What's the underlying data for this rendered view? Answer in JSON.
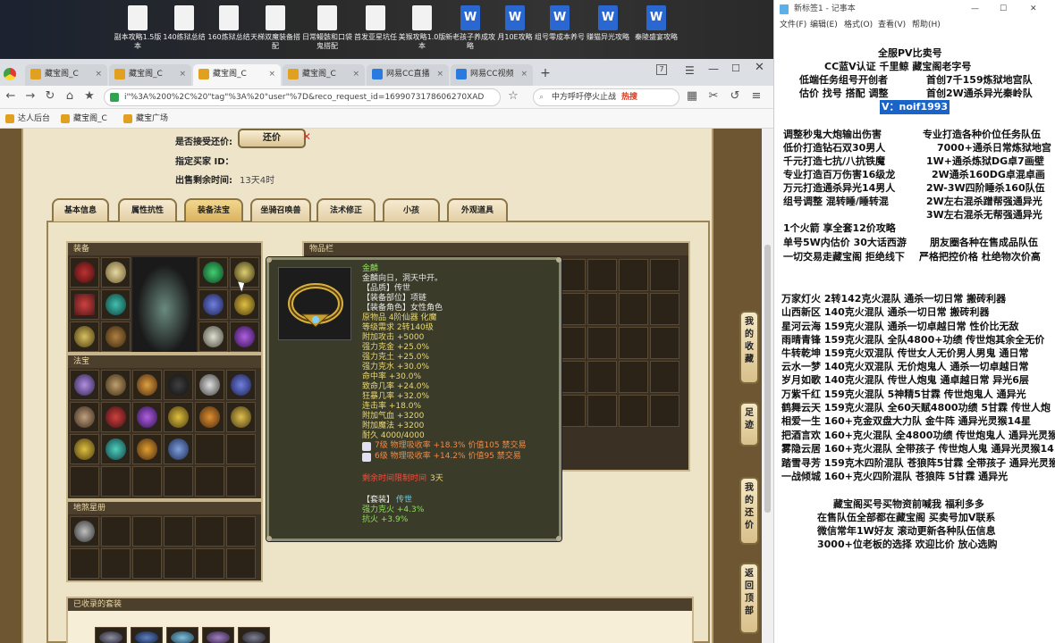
{
  "desktop": {
    "icons": [
      {
        "label": "副本攻略1.5版本",
        "type": "doc"
      },
      {
        "label": "140练狱总结",
        "type": "doc"
      },
      {
        "label": "160炼狱总结",
        "type": "doc"
      },
      {
        "label": "天梯双魔装备搭配",
        "type": "doc"
      },
      {
        "label": "日常鳗骸和口袋鬼搭配",
        "type": "doc"
      },
      {
        "label": "首发亚星坑任",
        "type": "doc"
      },
      {
        "label": "美猴攻略1.0版本",
        "type": "doc"
      },
      {
        "label": "新老孩子养成攻略",
        "type": "word"
      },
      {
        "label": "月10E攻略",
        "type": "word"
      },
      {
        "label": "组号零成本养号",
        "type": "word"
      },
      {
        "label": "赚猫异光攻略",
        "type": "word"
      },
      {
        "label": "秦陵盛宴攻略",
        "type": "word"
      }
    ]
  },
  "browser": {
    "tabs": [
      {
        "label": "藏宝阁_C"
      },
      {
        "label": "藏宝阁_C"
      },
      {
        "label": "藏宝阁_C"
      },
      {
        "label": "藏宝阁_C"
      },
      {
        "label": "网易CC直播"
      },
      {
        "label": "网易CC视频"
      }
    ],
    "new_tab": "+",
    "url": "i\"%3A%200%2C%20\"tag\"%3A%20\"user\"%7D&reco_request_id=1699073178606270XAD",
    "search": "中方呼吁停火止战",
    "hot_label": "热搜",
    "bookmarks": [
      {
        "label": "达人后台"
      },
      {
        "label": "藏宝阁_C"
      },
      {
        "label": "藏宝广场"
      }
    ]
  },
  "page": {
    "accept_offer_label": "是否接受还价:",
    "offer_button": "还价",
    "buyer_id_label": "指定买家 ID：",
    "time_left_label": "出售剩余时间:",
    "time_left_value": "13天4时",
    "tabs": [
      "基本信息",
      "属性抗性",
      "装备法宝",
      "坐骑召唤兽",
      "法术修正",
      "小孩",
      "外观道具"
    ],
    "active_tab": 2,
    "equip_title": "装备",
    "fabao_title": "法宝",
    "soul_title": "地煞星册",
    "inventory_title": "物品栏",
    "collected_title": "已收录的套装",
    "side_buttons": [
      "我的收藏",
      "足迹",
      "我的还价",
      "返回顶部"
    ]
  },
  "tooltip": {
    "name": "金麟",
    "desc": "金麟向日，洞天中开。",
    "quality": "【品质】传世",
    "slot": "【装备部位】项链",
    "role": "【装备角色】女性角色",
    "material": "原物品 4阶仙器 化魔",
    "level": "等级需求 2转140级",
    "stats": [
      "附加攻击 +5000",
      "强力克金 +25.0%",
      "强力克土 +25.0%",
      "强力克水 +30.0%",
      "命中率 +30.0%",
      "致命几率 +24.0%",
      "狂暴几率 +32.0%",
      "连击率 +18.0%",
      "附加气血 +3200",
      "附加魔法 +3200",
      "耐久 4000/4000"
    ],
    "gems": [
      "7级 物理吸收率 +18.3% 价值105 禁交易",
      "6级 物理吸收率 +14.2% 价值95 禁交易"
    ],
    "trade_limit": "剩余时间限制时间",
    "trade_limit_value": "3天",
    "set_label": "【套装】",
    "set_name": "传世",
    "set_stats": [
      "强力克火 +4.3%",
      "抗火 +3.9%"
    ]
  },
  "notepad": {
    "title": "新标签1 - 记事本",
    "menu": [
      "文件(F)",
      "编辑(E)",
      "格式(O)",
      "查看(V)",
      "帮助(H)"
    ],
    "lines": [
      "全服PV比卖号",
      "CC蓝V认证 千里鲸 藏宝阁老字号",
      "低端任务组号开创者",
      "首创7千159炼狱地宫队",
      "估价 找号 搭配 调整",
      "首创2W通杀异光秦岭队",
      "V：noif1993",
      "调整秒鬼大炮输出伤害",
      "专业打造各种价位任务队伍",
      "低价打造钻石双30男人",
      "7000+通杀日常炼狱地宫",
      "千元打造七抗/八抗铁魔",
      "1W+通杀炼狱DG卓7画壁",
      "专业打造百万伤害16级龙",
      "2W通杀160DG卓混卓画",
      "万元打造通杀异光14男人",
      "2W-3W四阶睡杀160队伍",
      "组号调整 混转睡/睡转混",
      "2W左右混杀蹭帮强通异光",
      "3W左右混杀无帮强通异光",
      "1个火箭 享全套12价攻略",
      "单号5W内估价 30大话西游",
      "朋友圈各种在售成品队伍",
      "一切交易走藏宝阁 拒绝线下",
      "严格把控价格 杜绝物次价高",
      "万家灯火 2转142克火混队 通杀一切日常 搬砖利器",
      "山西新区 140克火混队 通杀一切日常 搬砖利器",
      "星河云海 159克火混队 通杀一切卓越日常 性价比无敌",
      "雨晴青锋 159克火混队 全队4800+功绩 传世炮其余全无价",
      "牛转乾坤 159克火双混队 传世女人无价男人男鬼 通日常",
      "云水一梦 140克火双混队 无价炮鬼人 通杀一切卓越日常",
      "岁月如歌 140克火混队 传世人炮鬼 通卓越日常 异光6层",
      "万紫千红 159克火混队 5神精5甘霖 传世炮鬼人 通异光",
      "鹤舞云天 159克火混队 全60天赋4800功绩 5甘霖 传世人炮",
      "相爱一生 160+克金双盘大力队 金牛阵 通异光灵猴14星",
      "把酒言欢 160+克火混队 全4800功绩 传世炮鬼人 通异光灵猴",
      "雾隐云居 160+克火混队 全带孩子 传世炮人鬼 通异光灵猴14",
      "踏雪寻芳 159克木四阶混队 苍狼阵5甘霖 全带孩子 通异光灵猴",
      "一战倾城 160+克火四阶混队 苍狼阵 5甘霖 通异光",
      "藏宝阁买号买物资前喊我 福利多多",
      "在售队伍全部都在藏宝阁 买卖号加V联系",
      "微信常年1W好友 滚动更新各种队伍信息",
      "3000+位老板的选择 欢迎比价 放心选购"
    ]
  },
  "colors": {
    "parchment": "#eee4c9",
    "frame": "#6e5632",
    "tooltip_bg": "#3b3b29",
    "name_green": "#8de05a",
    "highlight": "#1a64c8"
  }
}
